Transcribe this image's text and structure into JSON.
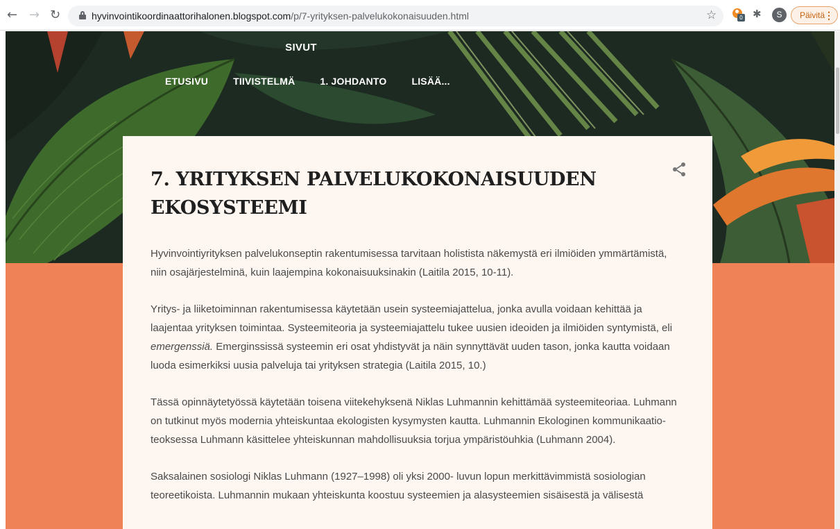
{
  "browser": {
    "back_icon": "arrow-left-icon",
    "forward_icon": "arrow-right-icon",
    "reload_icon": "reload-icon",
    "url_host": "hyvinvointikoordinaattorihalonen.blogspot.com",
    "url_path": "/p/7-yrityksen-palvelukokonaisuuden.html",
    "ext_badge": "0",
    "avatar_initial": "S",
    "update_label": "Päivitä"
  },
  "blog": {
    "pages_heading": "SIVUT",
    "nav": [
      "ETUSIVU",
      "TIIVISTELMÄ",
      "1. JOHDANTO",
      "LISÄÄ..."
    ]
  },
  "post": {
    "title": "7. YRITYKSEN PALVELUKOKONAISUUDEN EKOSYSTEEMI",
    "p1": "Hyvinvointiyrityksen palvelukonseptin rakentumisessa tarvitaan holistista näkemystä eri ilmiöiden ymmärtämistä, niin osajärjestelminä, kuin laajempina kokonaisuuksinakin (Laitila 2015, 10-11).",
    "p2_a": "Yritys- ja liiketoiminnan rakentumisessa käytetään usein systeemiajattelua, jonka avulla voidaan kehittää ja laajentaa yrityksen toimintaa. Systeemiteoria ja systeemiajattelu tukee uusien ideoiden ja ilmiöiden syntymistä, eli ",
    "p2_em": "emergenssiä.",
    "p2_b": " Emerginssissä systeemin eri osat yhdistyvät ja näin synnyttävät uuden tason, jonka kautta voidaan luoda esimerkiksi uusia palveluja tai yrityksen strategia (Laitila 2015, 10.)",
    "p3": "Tässä opinnäytetyössä käytetään toisena viitekehyksenä Niklas Luhmannin kehittämää systeemiteoriaa. Luhmann on tutkinut myös modernia yhteiskuntaa ekologisten kysymysten kautta. Luhmannin Ekologinen kommunikaatio- teoksessa Luhmann käsittelee yhteiskunnan mahdollisuuksia torjua ympäristöuhkia (Luhmann 2004).",
    "p4": "Saksalainen sosiologi Niklas Luhmann (1927–1998) oli yksi 2000- luvun lopun merkittävimmistä sosiologian teoreetikoista. Luhmannin mukaan yhteiskunta koostuu systeemien ja alasysteemien sisäisestä ja välisestä"
  },
  "colors": {
    "accent_orange": "#f08258",
    "card_bg": "#fdf6f1",
    "hero_dark": "#1d2a22"
  }
}
